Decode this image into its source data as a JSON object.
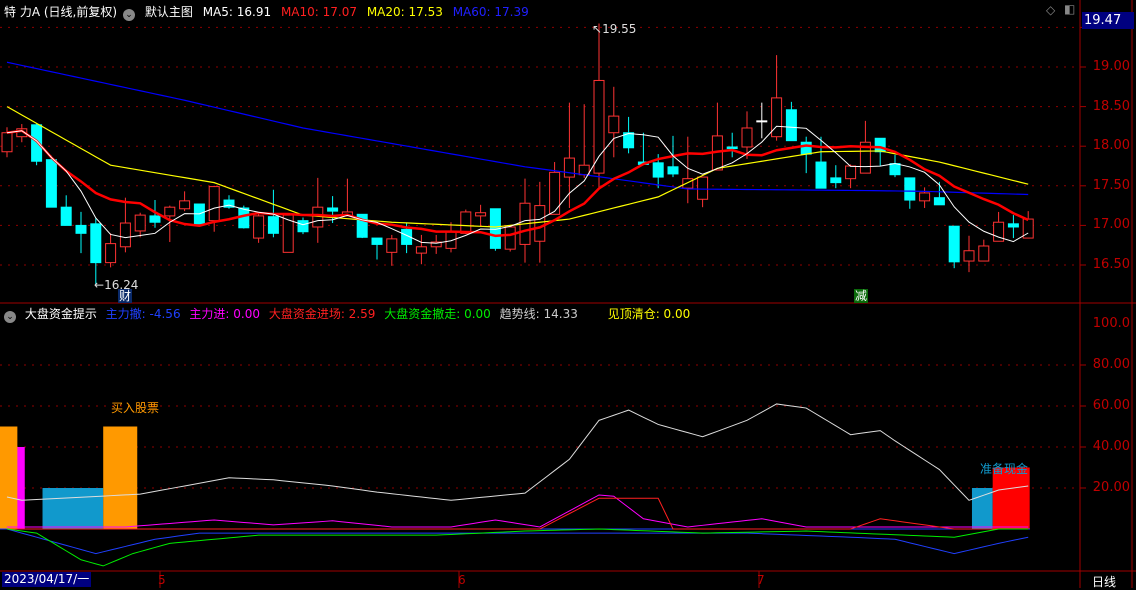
{
  "header": {
    "stock": "特 力A (日线,前复权)",
    "template": "默认主图",
    "ma5": "MA5: 16.91",
    "ma10": "MA10: 17.07",
    "ma20": "MA20: 17.53",
    "ma60": "MA60: 17.39"
  },
  "indicator": {
    "name": "大盘资金提示",
    "l1": "主力撤: -4.56",
    "l2": "主力进: 0.00",
    "l3": "大盘资金进场: 2.59",
    "l4": "大盘资金撤走: 0.00",
    "l5": "趋势线: 14.33",
    "l6": "见顶清仓: 0.00"
  },
  "price_axis": [
    "19.00",
    "18.50",
    "18.00",
    "17.50",
    "17.00",
    "16.50"
  ],
  "current_price": "19.47",
  "ind_axis": [
    "100.0",
    "80.00",
    "60.00",
    "40.00",
    "20.00"
  ],
  "xaxis": {
    "date": "2023/04/17/一",
    "months": [
      "5",
      "6",
      "7"
    ],
    "period": "日线"
  },
  "annotations": {
    "high": "19.55",
    "low": "16.24",
    "mark_cai": "财",
    "mark_jian": "减",
    "buy": "买入股票",
    "cash": "准备现金"
  },
  "colors": {
    "up": "#ff3333",
    "down": "#00ffff",
    "ma5": "#ffffff",
    "ma10": "#ff0000",
    "ma20": "#ffff00",
    "ma60": "#0000ff",
    "grid": "#900000"
  },
  "chart_data": {
    "type": "candlestick",
    "price_range": [
      16.0,
      19.6
    ],
    "candles": [
      [
        17.93,
        18.17,
        18.24,
        17.86
      ],
      [
        18.12,
        18.22,
        18.28,
        18.05
      ],
      [
        18.27,
        17.81,
        18.29,
        17.76
      ],
      [
        17.83,
        17.23,
        17.88,
        17.23
      ],
      [
        17.23,
        17.0,
        17.38,
        17.0
      ],
      [
        17.0,
        16.9,
        17.17,
        16.65
      ],
      [
        17.02,
        16.53,
        17.09,
        16.24
      ],
      [
        16.53,
        16.77,
        16.9,
        16.47
      ],
      [
        16.73,
        17.03,
        17.35,
        16.66
      ],
      [
        16.93,
        17.13,
        17.16,
        16.85
      ],
      [
        17.12,
        17.04,
        17.32,
        16.97
      ],
      [
        17.12,
        17.23,
        17.25,
        16.79
      ],
      [
        17.21,
        17.31,
        17.43,
        17.18
      ],
      [
        17.27,
        17.02,
        17.27,
        17.02
      ],
      [
        17.06,
        17.49,
        17.5,
        16.92
      ],
      [
        17.32,
        17.23,
        17.38,
        17.21
      ],
      [
        17.22,
        16.97,
        17.25,
        16.96
      ],
      [
        16.84,
        17.12,
        17.16,
        16.78
      ],
      [
        17.11,
        16.9,
        17.45,
        16.85
      ],
      [
        16.66,
        17.13,
        17.13,
        16.66
      ],
      [
        17.06,
        16.92,
        17.1,
        16.89
      ],
      [
        16.98,
        17.23,
        17.6,
        16.78
      ],
      [
        17.22,
        17.18,
        17.37,
        17.03
      ],
      [
        17.12,
        17.17,
        17.59,
        17.12
      ],
      [
        17.14,
        16.85,
        17.14,
        16.84
      ],
      [
        16.84,
        16.76,
        16.84,
        16.57
      ],
      [
        16.66,
        16.83,
        16.88,
        16.49
      ],
      [
        16.95,
        16.76,
        17.03,
        16.65
      ],
      [
        16.65,
        16.73,
        16.88,
        16.51
      ],
      [
        16.73,
        16.79,
        16.88,
        16.64
      ],
      [
        16.71,
        16.92,
        17.04,
        16.66
      ],
      [
        16.9,
        17.17,
        17.2,
        16.89
      ],
      [
        17.12,
        17.16,
        17.26,
        16.98
      ],
      [
        17.21,
        16.71,
        17.21,
        16.68
      ],
      [
        16.7,
        16.98,
        16.98,
        16.67
      ],
      [
        16.76,
        17.28,
        17.59,
        16.53
      ],
      [
        16.8,
        17.25,
        17.55,
        16.53
      ],
      [
        17.14,
        17.67,
        17.8,
        17.14
      ],
      [
        17.61,
        17.85,
        18.55,
        17.22
      ],
      [
        17.64,
        17.76,
        18.53,
        17.6
      ],
      [
        17.66,
        18.83,
        19.55,
        17.45
      ],
      [
        18.17,
        18.38,
        18.75,
        17.86
      ],
      [
        18.17,
        17.98,
        18.37,
        17.91
      ],
      [
        17.8,
        17.77,
        18.17,
        17.77
      ],
      [
        17.79,
        17.61,
        17.9,
        17.47
      ],
      [
        17.74,
        17.65,
        18.13,
        17.61
      ],
      [
        17.47,
        17.59,
        18.12,
        17.28
      ],
      [
        17.33,
        17.61,
        17.61,
        17.23
      ],
      [
        17.7,
        18.13,
        18.55,
        17.7
      ],
      [
        17.99,
        17.97,
        18.17,
        17.86
      ],
      [
        17.99,
        18.23,
        18.44,
        17.84
      ],
      [
        18.32,
        18.32,
        18.55,
        18.1
      ],
      [
        18.12,
        18.61,
        19.15,
        18.07
      ],
      [
        18.46,
        18.07,
        18.56,
        18.07
      ],
      [
        18.05,
        17.9,
        18.12,
        17.66
      ],
      [
        17.8,
        17.47,
        18.12,
        17.47
      ],
      [
        17.6,
        17.54,
        17.76,
        17.47
      ],
      [
        17.59,
        17.75,
        17.77,
        17.47
      ],
      [
        17.66,
        18.05,
        18.32,
        17.66
      ],
      [
        18.1,
        17.93,
        18.1,
        17.75
      ],
      [
        17.78,
        17.64,
        17.89,
        17.61
      ],
      [
        17.6,
        17.32,
        17.6,
        17.21
      ],
      [
        17.31,
        17.41,
        17.48,
        17.22
      ],
      [
        17.35,
        17.26,
        17.55,
        17.26
      ],
      [
        16.99,
        16.54,
        16.99,
        16.46
      ],
      [
        16.55,
        16.68,
        16.87,
        16.41
      ],
      [
        16.55,
        16.74,
        16.82,
        16.55
      ],
      [
        16.8,
        17.04,
        17.17,
        16.8
      ],
      [
        17.02,
        16.98,
        17.13,
        16.84
      ],
      [
        16.84,
        17.08,
        17.18,
        16.84
      ]
    ],
    "ma20_points": [
      [
        0,
        18.5
      ],
      [
        7,
        17.76
      ],
      [
        14,
        17.54
      ],
      [
        20,
        17.13
      ],
      [
        26,
        17.04
      ],
      [
        33,
        16.98
      ],
      [
        38,
        17.08
      ],
      [
        44,
        17.36
      ],
      [
        48,
        17.72
      ],
      [
        55,
        17.93
      ],
      [
        59,
        17.94
      ],
      [
        63,
        17.8
      ],
      [
        69,
        17.52
      ]
    ],
    "ma60_points": [
      [
        0,
        19.06
      ],
      [
        12,
        18.58
      ],
      [
        20,
        18.23
      ],
      [
        35,
        17.74
      ],
      [
        39,
        17.64
      ],
      [
        46,
        17.46
      ],
      [
        58,
        17.44
      ],
      [
        62,
        17.43
      ],
      [
        69,
        17.39
      ]
    ],
    "ind_range": [
      -20,
      110
    ],
    "ind_lines": [
      {
        "name": "趋势线",
        "color": "#dddddd",
        "pts": [
          [
            0,
            15.6
          ],
          [
            1,
            14
          ],
          [
            9,
            17
          ],
          [
            12,
            21
          ],
          [
            15,
            25
          ],
          [
            18,
            24
          ],
          [
            22,
            21
          ],
          [
            25,
            18
          ],
          [
            30,
            14
          ],
          [
            35,
            17.5
          ],
          [
            38,
            34
          ],
          [
            40,
            53
          ],
          [
            42,
            58
          ],
          [
            44,
            51
          ],
          [
            47,
            45
          ],
          [
            50,
            53
          ],
          [
            52,
            61
          ],
          [
            54,
            59
          ],
          [
            57,
            46
          ],
          [
            59,
            48
          ],
          [
            60,
            43
          ],
          [
            63,
            29
          ],
          [
            65,
            14
          ],
          [
            67,
            19
          ],
          [
            69,
            21
          ]
        ]
      },
      {
        "name": "主力进",
        "color": "#ff00ff",
        "pts": [
          [
            0,
            1
          ],
          [
            8,
            1
          ],
          [
            14,
            4.4
          ],
          [
            18,
            2
          ],
          [
            22,
            4
          ],
          [
            26,
            1
          ],
          [
            30,
            1
          ],
          [
            33,
            4.4
          ],
          [
            36,
            1
          ],
          [
            40,
            16.6
          ],
          [
            41,
            16
          ],
          [
            43,
            5
          ],
          [
            46,
            1
          ],
          [
            51,
            5
          ],
          [
            54,
            1
          ],
          [
            69,
            1
          ]
        ]
      },
      {
        "name": "大盘资金进场",
        "color": "#ff2020",
        "pts": [
          [
            0,
            0
          ],
          [
            36,
            0
          ],
          [
            40,
            15
          ],
          [
            42,
            15
          ],
          [
            44,
            15
          ],
          [
            45,
            0
          ],
          [
            57,
            0
          ],
          [
            59,
            5
          ],
          [
            62,
            2
          ],
          [
            64,
            0
          ],
          [
            69,
            0
          ]
        ]
      },
      {
        "name": "主力撤",
        "color": "#2040ff",
        "pts": [
          [
            0,
            0
          ],
          [
            4,
            -8
          ],
          [
            6,
            -12
          ],
          [
            10,
            -5
          ],
          [
            13,
            -2
          ],
          [
            50,
            -2
          ],
          [
            57,
            -4
          ],
          [
            60,
            -5
          ],
          [
            64,
            -12
          ],
          [
            67,
            -7
          ],
          [
            69,
            -4
          ]
        ]
      },
      {
        "name": "大盘资金撤走",
        "color": "#00ee00",
        "pts": [
          [
            0,
            0
          ],
          [
            2,
            -2
          ],
          [
            5,
            -15
          ],
          [
            6.5,
            -18
          ],
          [
            8.5,
            -12
          ],
          [
            11,
            -7
          ],
          [
            17,
            -3
          ],
          [
            29,
            -3
          ],
          [
            35,
            -1
          ],
          [
            40,
            0
          ],
          [
            47,
            -2
          ],
          [
            54,
            -1
          ],
          [
            64,
            -4
          ],
          [
            67,
            0
          ],
          [
            69,
            0
          ]
        ]
      }
    ],
    "ind_bars": [
      {
        "from": -0.5,
        "to": 1.2,
        "value": 40,
        "color": "#ff00ff"
      },
      {
        "from": -0.5,
        "to": 0.7,
        "value": 50,
        "color": "#ff9900"
      },
      {
        "from": 2.4,
        "to": 6.5,
        "value": 20,
        "color": "#1199cc"
      },
      {
        "from": 6.5,
        "to": 8.8,
        "value": 50,
        "color": "#ff9900"
      },
      {
        "from": 65.2,
        "to": 66.6,
        "value": 20,
        "color": "#1199cc"
      },
      {
        "from": 66.6,
        "to": 69.1,
        "value": 30,
        "color": "#ff0000"
      }
    ]
  }
}
